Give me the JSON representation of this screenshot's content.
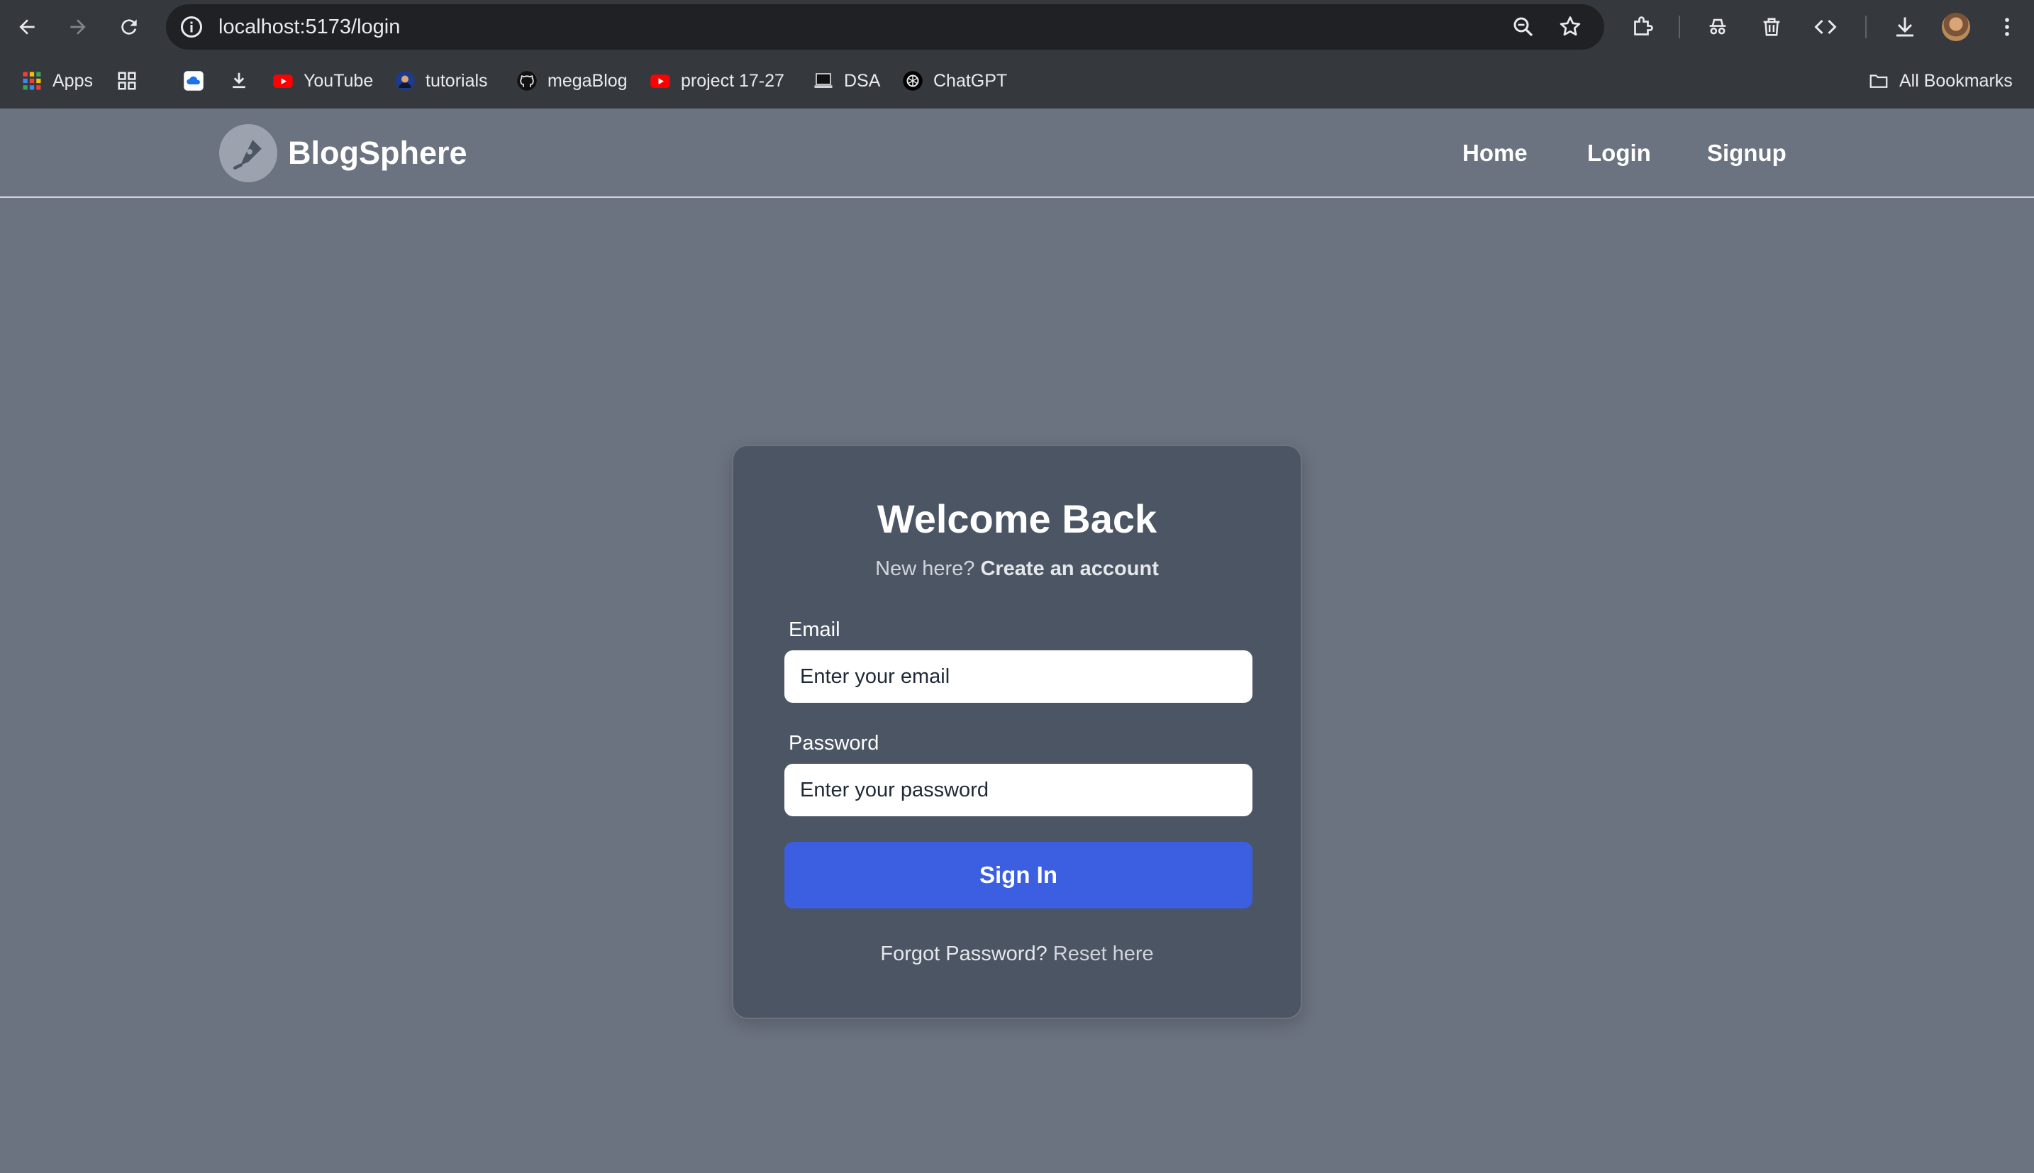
{
  "browser": {
    "url": "localhost:5173/login",
    "bookmarks": [
      {
        "label": "Apps",
        "icon": "apps-grid-icon"
      },
      {
        "label": "",
        "icon": "tab-groups-icon"
      },
      {
        "label": "",
        "icon": "cloud-icon"
      },
      {
        "label": "",
        "icon": "download-icon"
      },
      {
        "label": "YouTube",
        "icon": "youtube-icon"
      },
      {
        "label": "tutorials",
        "icon": "avatar-icon"
      },
      {
        "label": "megaBlog",
        "icon": "github-icon"
      },
      {
        "label": "project 17-27",
        "icon": "youtube-icon"
      },
      {
        "label": "DSA",
        "icon": "laptop-icon"
      },
      {
        "label": "ChatGPT",
        "icon": "chatgpt-icon"
      }
    ],
    "all_bookmarks": "All Bookmarks"
  },
  "header": {
    "brand": "BlogSphere",
    "nav": [
      {
        "label": "Home"
      },
      {
        "label": "Login"
      },
      {
        "label": "Signup"
      }
    ]
  },
  "login": {
    "title": "Welcome Back",
    "subtitle_prefix": "New here?",
    "subtitle_link": "Create an account",
    "email_label": "Email",
    "email_placeholder": "Enter your email",
    "password_label": "Password",
    "password_placeholder": "Enter your password",
    "submit_label": "Sign In",
    "forgot_prefix": "Forgot Password?",
    "forgot_link": "Reset here"
  },
  "colors": {
    "page_bg": "#6b7280",
    "card_bg": "#4b5563",
    "button_bg": "#3b5fe0",
    "chrome_bg": "#35393e"
  }
}
